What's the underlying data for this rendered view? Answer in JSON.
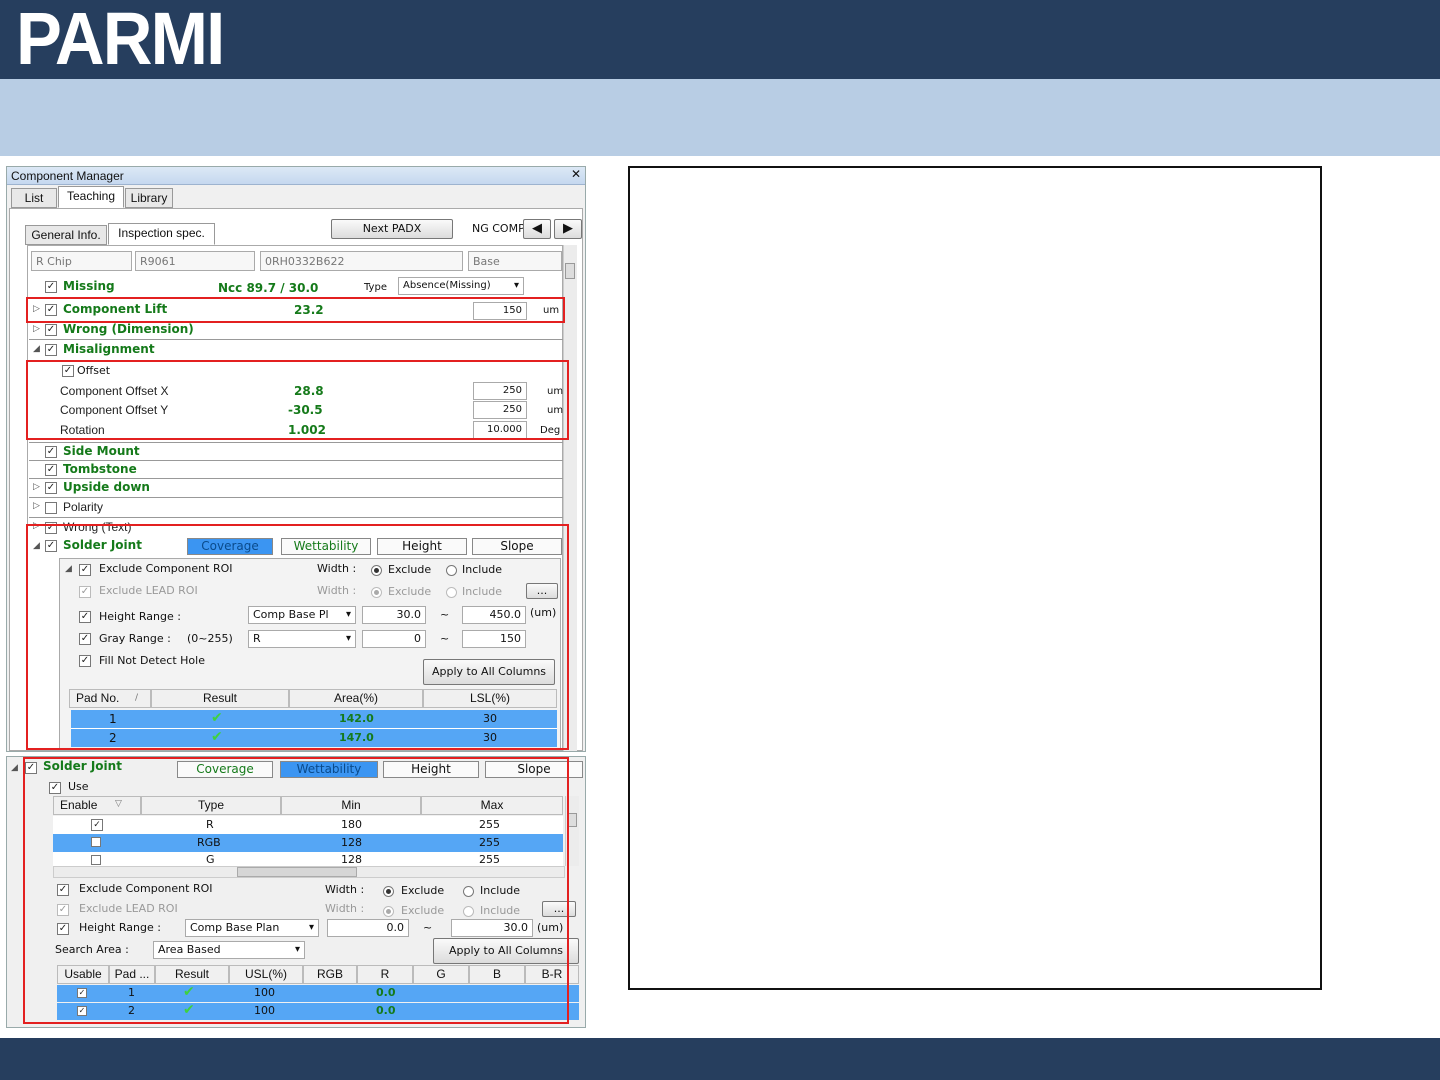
{
  "header": {
    "logo": "PARMI"
  },
  "panel1": {
    "title": "Component Manager",
    "close": "✕",
    "tabs": [
      "List",
      "Teaching",
      "Library"
    ],
    "subtabs": [
      "General Info.",
      "Inspection spec."
    ],
    "next_padx": "Next PADX",
    "ng_comp": "NG COMP",
    "prev_icon": "◀",
    "next_icon": "▶",
    "info_fields": [
      "R Chip",
      "R9061",
      "0RH0332B622",
      "Base"
    ],
    "missing": {
      "label": "Missing",
      "value": "Ncc 89.7 / 30.0",
      "type_label": "Type",
      "type_value": "Absence(Missing)"
    },
    "lift": {
      "label": "Component  Lift",
      "value": "23.2",
      "input": "150",
      "unit": "um"
    },
    "wrong_dim": "Wrong (Dimension)",
    "misalignment": "Misalignment",
    "offset": "Offset",
    "offset_rows": [
      {
        "label": "Component Offset X",
        "value": "28.8",
        "input": "250",
        "unit": "um"
      },
      {
        "label": "Component Offset Y",
        "value": "-30.5",
        "input": "250",
        "unit": "um"
      },
      {
        "label": "Rotation",
        "value": "1.002",
        "input": "10.000",
        "unit": "Deg"
      }
    ],
    "side_mount": "Side Mount",
    "tombstone": "Tombstone",
    "upside_down": "Upside down",
    "polarity": "Polarity",
    "wrong_text": "Wrong (Text)",
    "solder_joint": "Solder Joint",
    "seg_tabs": [
      "Coverage",
      "Wettability",
      "Height",
      "Slope"
    ],
    "exclude_comp": "Exclude Component ROI",
    "exclude_lead": "Exclude LEAD ROI",
    "width": "Width :",
    "exclude": "Exclude",
    "include": "Include",
    "ellipsis": "...",
    "height_range": "Height Range :",
    "height_mode": "Comp Base Pl",
    "height_min": "30.0",
    "height_max": "450.0",
    "tilde": "~",
    "um": "(um)",
    "gray_range": "Gray Range :",
    "gray_hint": "(0~255)",
    "gray_channel": "R",
    "gray_min": "0",
    "gray_max": "150",
    "fill_hole": "Fill Not Detect Hole",
    "apply": "Apply to All Columns",
    "grid_headers": [
      "Pad No.",
      "Result",
      "Area(%)",
      "LSL(%)"
    ],
    "sort_icon": "/",
    "rows": [
      {
        "pad": "1",
        "area": "142.0",
        "lsl": "30"
      },
      {
        "pad": "2",
        "area": "147.0",
        "lsl": "30"
      }
    ]
  },
  "panel2": {
    "solder_joint": "Solder Joint",
    "seg_tabs": [
      "Coverage",
      "Wettability",
      "Height",
      "Slope"
    ],
    "use": "Use",
    "grid_headers": [
      "Enable",
      "Type",
      "Min",
      "Max"
    ],
    "filter_icon": "▽",
    "grid_rows": [
      {
        "enabled": true,
        "type": "R",
        "min": "180",
        "max": "255"
      },
      {
        "enabled": false,
        "type": "RGB",
        "min": "128",
        "max": "255"
      },
      {
        "enabled": false,
        "type": "G",
        "min": "128",
        "max": "255"
      }
    ],
    "exclude_comp": "Exclude Component ROI",
    "exclude_lead": "Exclude LEAD ROI",
    "width": "Width :",
    "exclude": "Exclude",
    "include": "Include",
    "ellipsis": "...",
    "height_range": "Height Range :",
    "height_mode": "Comp Base Plan",
    "height_min": "0.0",
    "height_max": "30.0",
    "tilde": "~",
    "um": "(um)",
    "search_area": "Search Area :",
    "search_value": "Area Based",
    "apply": "Apply to All Columns",
    "grid2_headers": [
      "Usable",
      "Pad ...",
      "Result",
      "USL(%)",
      "RGB",
      "R",
      "G",
      "B",
      "B-R"
    ],
    "rows": [
      {
        "pad": "1",
        "usl": "100",
        "r": "0.0"
      },
      {
        "pad": "2",
        "usl": "100",
        "r": "0.0"
      }
    ]
  }
}
